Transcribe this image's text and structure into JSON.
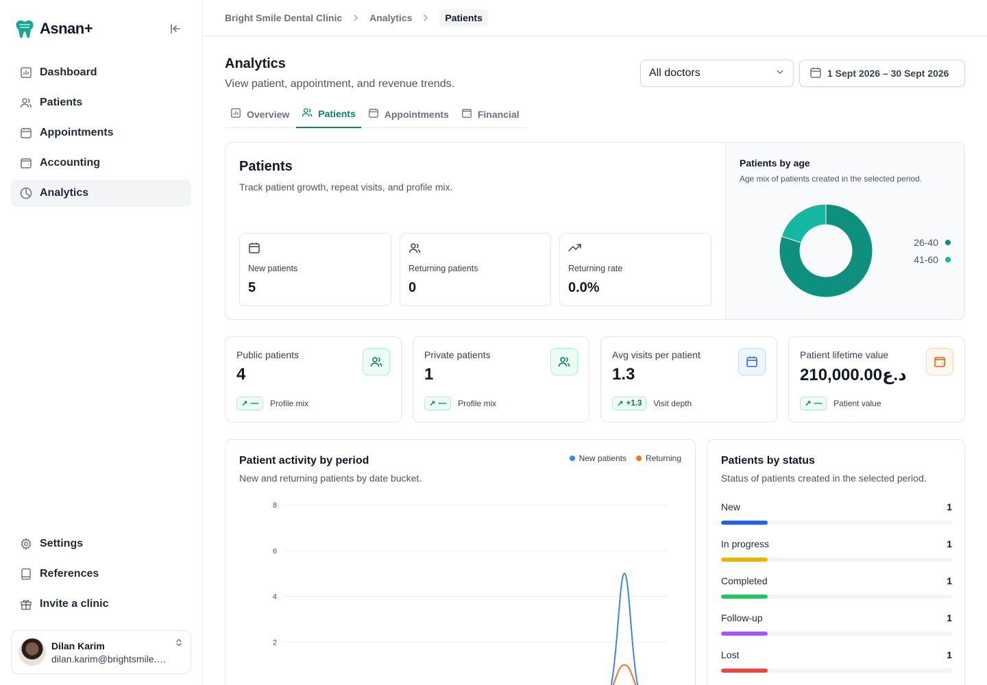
{
  "brand": {
    "name": "Asnan+"
  },
  "sidebar": {
    "items": [
      {
        "label": "Dashboard",
        "icon": "bar-chart-icon"
      },
      {
        "label": "Patients",
        "icon": "users-icon"
      },
      {
        "label": "Appointments",
        "icon": "calendar-icon"
      },
      {
        "label": "Accounting",
        "icon": "wallet-icon"
      },
      {
        "label": "Analytics",
        "icon": "pie-chart-icon",
        "active": true
      }
    ],
    "bottom_items": [
      {
        "label": "Settings",
        "icon": "gear-icon"
      },
      {
        "label": "References",
        "icon": "book-icon"
      },
      {
        "label": "Invite a clinic",
        "icon": "gift-icon"
      }
    ],
    "user": {
      "name": "Dilan Karim",
      "email": "dilan.karim@brightsmile.ex..."
    }
  },
  "breadcrumb": [
    "Bright Smile Dental Clinic",
    "Analytics",
    "Patients"
  ],
  "header": {
    "title": "Analytics",
    "subtitle": "View patient, appointment, and revenue trends.",
    "doctor_filter": "All doctors",
    "date_range": "1 Sept 2026 – 30 Sept 2026"
  },
  "tabs": [
    {
      "label": "Overview"
    },
    {
      "label": "Patients",
      "active": true
    },
    {
      "label": "Appointments"
    },
    {
      "label": "Financial"
    }
  ],
  "patients_card": {
    "title": "Patients",
    "subtitle": "Track patient growth, repeat visits, and profile mix.",
    "metrics": [
      {
        "label": "New patients",
        "value": "5"
      },
      {
        "label": "Returning patients",
        "value": "0"
      },
      {
        "label": "Returning rate",
        "value": "0.0%"
      }
    ]
  },
  "age_chart": {
    "title": "Patients by age",
    "subtitle": "Age mix of patients created in the selected period.",
    "legend": [
      {
        "label": "26-40",
        "color": "#0f8f7e"
      },
      {
        "label": "41-60",
        "color": "#14b8a0"
      }
    ]
  },
  "stats": [
    {
      "label": "Public patients",
      "value": "4",
      "badge": "—",
      "foot": "Profile mix",
      "icon": "users-icon",
      "tone": "green"
    },
    {
      "label": "Private patients",
      "value": "1",
      "badge": "—",
      "foot": "Profile mix",
      "icon": "users-icon",
      "tone": "green"
    },
    {
      "label": "Avg visits per patient",
      "value": "1.3",
      "badge": "+1.3",
      "foot": "Visit depth",
      "icon": "calendar-icon",
      "tone": "blue"
    },
    {
      "label": "Patient lifetime value",
      "value": "210,000.00د.ع",
      "badge": "—",
      "foot": "Patient value",
      "icon": "wallet-icon",
      "tone": "orange"
    }
  ],
  "activity": {
    "title": "Patient activity by period",
    "subtitle": "New and returning patients by date bucket.",
    "legend_new": "New patients",
    "legend_returning": "Returning"
  },
  "status": {
    "title": "Patients by status",
    "subtitle": "Status of patients created in the selected period.",
    "rows": [
      {
        "label": "New",
        "count": "1",
        "color": "#2563eb"
      },
      {
        "label": "In progress",
        "count": "1",
        "color": "#eab308"
      },
      {
        "label": "Completed",
        "count": "1",
        "color": "#22c55e"
      },
      {
        "label": "Follow-up",
        "count": "1",
        "color": "#a855f7"
      },
      {
        "label": "Lost",
        "count": "1",
        "color": "#ef4444"
      }
    ]
  },
  "chart_data": [
    {
      "type": "pie",
      "title": "Patients by age",
      "labels": [
        "26-40",
        "41-60"
      ],
      "values": [
        4,
        1
      ],
      "colors": [
        "#0f8f7e",
        "#14b8a0"
      ]
    },
    {
      "type": "line",
      "title": "Patient activity by period",
      "ylim": [
        0,
        8
      ],
      "yticks": [
        "0",
        "2",
        "4",
        "6",
        "8"
      ],
      "series": [
        {
          "name": "New patients",
          "color": "#3b82f6",
          "peak": 5
        },
        {
          "name": "Returning",
          "color": "#f97316",
          "peak": 1
        }
      ]
    }
  ]
}
